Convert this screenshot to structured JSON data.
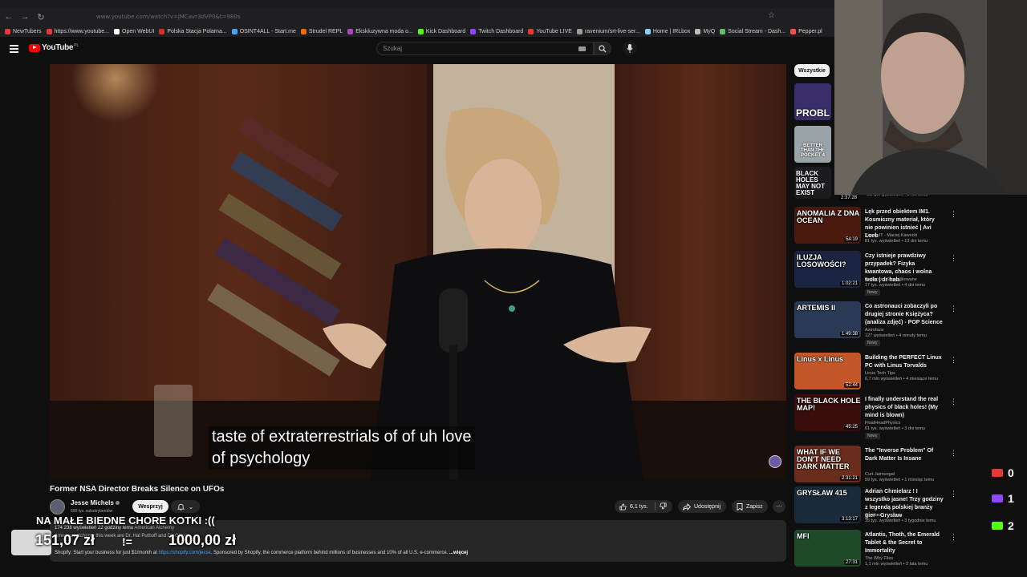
{
  "browser": {
    "url": "www.youtube.com/watch?v=jMCavr3dVP0&t=980s",
    "bookmarks": [
      {
        "label": "NewTubers",
        "color": "#e53935"
      },
      {
        "label": "https://www.youtube...",
        "color": "#e53935"
      },
      {
        "label": "Open WebUI",
        "color": "#ffffff"
      },
      {
        "label": "Polska Stacja Polarna...",
        "color": "#d32f2f"
      },
      {
        "label": "OSINT4ALL - Start.me",
        "color": "#42a5f5"
      },
      {
        "label": "Strudel REPL",
        "color": "#ef6c00"
      },
      {
        "label": "Ekskluzywna moda o...",
        "color": "#ab47bc"
      },
      {
        "label": "Kick Dashboard",
        "color": "#53fc18"
      },
      {
        "label": "Twitch Dashboard",
        "color": "#9146ff"
      },
      {
        "label": "YouTube LIVE",
        "color": "#e53935"
      },
      {
        "label": "ravenium/srt-live-ser...",
        "color": "#9e9e9e"
      },
      {
        "label": "Home | IRLbox",
        "color": "#90caf9"
      },
      {
        "label": "MyQ",
        "color": "#bdbdbd"
      },
      {
        "label": "Social Stream - Dash...",
        "color": "#66bb6a"
      },
      {
        "label": "Pepper.pl",
        "color": "#ef5350"
      }
    ]
  },
  "header": {
    "logo_text": "YouTube",
    "logo_region": "PL",
    "search_placeholder": "Szukaj"
  },
  "video": {
    "caption_line1": "taste of extraterrestrials of of uh love",
    "caption_line2": "of psychology",
    "title": "Former NSA Director Breaks Silence on UFOs",
    "channel": "Jesse Michels",
    "subscribers": "600 tys. subskrybentów",
    "support_label": "Wesprzyj",
    "likes": "6,1 tys.",
    "share_label": "Udostępnij",
    "save_label": "Zapisz",
    "views_date": "174 238 wyświetleń  22 godziny temu",
    "tag": "American Alchemy",
    "desc_line2": "American Alchemy this week are Dr. Hal Puthoff and Dr. Gilbert...",
    "desc_line3_pre": "Shopify: Start your business for just $1/month at",
    "desc_link": "https://shopify.com/jesse",
    "desc_line3_post": ". Sponsored by Shopify, the commerce platform behind millions of businesses and 10% of all U.S. e-commerce.",
    "more_label": "...więcej"
  },
  "donation": {
    "title": "NA MAŁE BIEDNE CHORE KOTKI :((",
    "current": "151,07 zł",
    "separator": "!=",
    "goal": "1000,00 zł"
  },
  "sidebar": {
    "chip_label": "Wszystkie",
    "small_thumbs": [
      {
        "text": "PROBL",
        "color": "#3a2e6a"
      },
      {
        "text": "BETTER THAN THE POCKET 4",
        "color": "#9aa3a8"
      },
      {
        "text": "BLACK HOLES MAY NOT EXIST",
        "color": "#1c1c20"
      }
    ],
    "partial_meta": "403 tys. wyświetleń • 1 rok temu",
    "partial_duration": "2:37:28",
    "items": [
      {
        "title": "Lęk przed obiektem IM1. Kosmiczny materiał, który nie powinien istnieć | Avi Loeb",
        "channel": "This Is IT - Maciej Kawecki",
        "meta": "81 tys. wyświetleń • 13 dni temu",
        "duration": "54:19",
        "thumb_text": "ANOMALIA Z DNA OCEAN",
        "thumb_color": "#4a1a0e",
        "badge": ""
      },
      {
        "title": "Czy istnieje prawdziwy przypadek? Fizyka kwantowa, chaos i wolna wola | dr hab.",
        "channel": "To Bardzo Skomplikowane",
        "meta": "17 tys. wyświetleń • 4 dni temu",
        "duration": "1:02:21",
        "thumb_text": "ILUZJA LOSOWOŚCI?",
        "thumb_color": "#1b2440",
        "badge": "Nowy"
      },
      {
        "title": "Co astronauci zobaczyli po drugiej stronie Księżyca? (analiza zdjęć) - POP Science",
        "channel": "Astrofaza",
        "meta": "127 wyświetleń • 4 minuty temu",
        "duration": "1:49:38",
        "thumb_text": "ARTEMIS II",
        "thumb_color": "#2a3a55",
        "badge": "Nowy"
      },
      {
        "title": "Building the PERFECT Linux PC with Linus Torvalds",
        "channel": "Linus Tech Tips",
        "meta": "6,7 mln wyświetleń • 4 miesiące temu",
        "duration": "52:44",
        "thumb_text": "Linus x Linus",
        "thumb_color": "#c4572a",
        "badge": ""
      },
      {
        "title": "I finally understand the real physics of black holes! (My mind is blown)",
        "channel": "FloatHeadPhysics",
        "meta": "61 tys. wyświetleń • 3 dni temu",
        "duration": "45:25",
        "thumb_text": "THE BLACK HOLE MAP!",
        "thumb_color": "#3a0d0d",
        "badge": "Nowy"
      },
      {
        "title": "The \"Inverse Problem\" Of Dark Matter Is Insane",
        "channel": "Curt Jaimungal",
        "meta": "59 tys. wyświetleń • 1 miesiąc temu",
        "duration": "2:31:21",
        "thumb_text": "WHAT IF WE DON'T NEED DARK MATTER",
        "thumb_color": "#6a2c1c",
        "badge": ""
      },
      {
        "title": "Adrian Chmielarz ! I wszystko jasne! Trzy godziny z legendą polskiej branży gier · Grysław",
        "channel": "Grysław",
        "meta": "35 tys. wyświetleń • 3 tygodnie temu",
        "duration": "3:13:17",
        "thumb_text": "GRYSŁAW 415",
        "thumb_color": "#1a2a3a",
        "badge": ""
      },
      {
        "title": "Atlantis, Thoth, the Emerald Tablet & the Secret to Immortality",
        "channel": "The Why Files",
        "meta": "1,1 mln wyświetleń • 2 lata temu",
        "duration": "27:31",
        "thumb_text": "MFI",
        "thumb_color": "#1e4a2a",
        "badge": ""
      }
    ]
  },
  "stream_stats": [
    {
      "value": "0",
      "color": "#e53935"
    },
    {
      "value": "1",
      "color": "#9146ff"
    },
    {
      "value": "2",
      "color": "#53fc18"
    }
  ]
}
